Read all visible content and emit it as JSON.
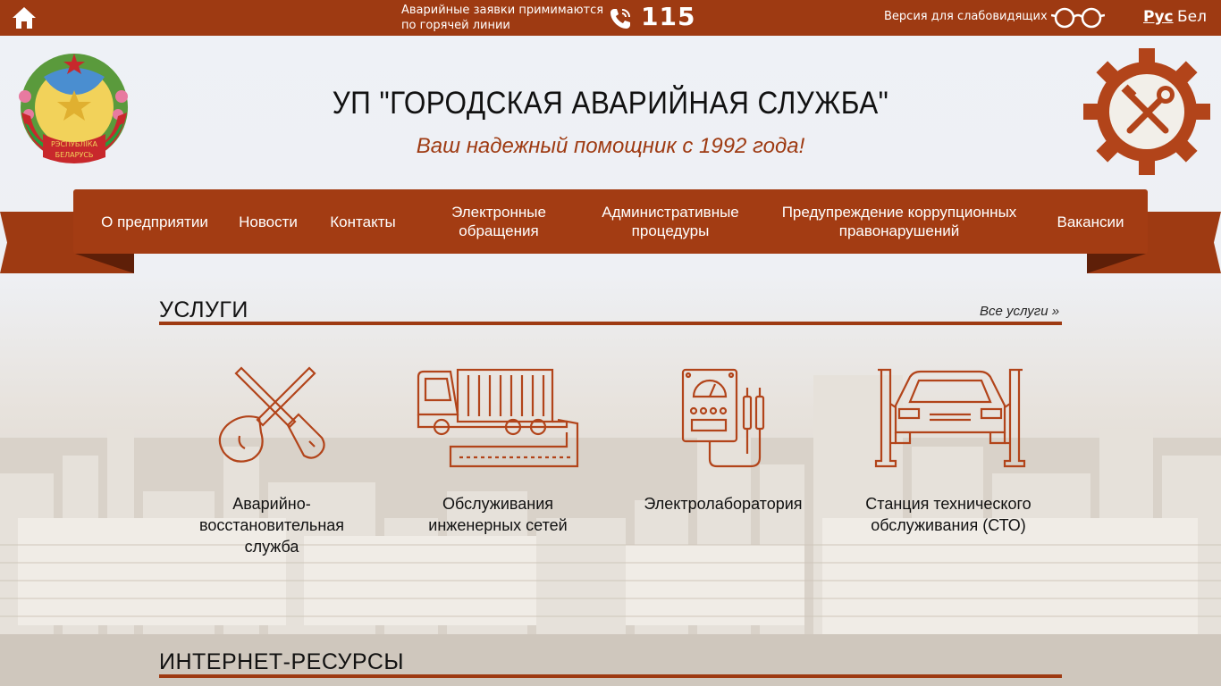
{
  "topbar": {
    "hotline_text_1": "Аварийные заявки примимаются",
    "hotline_text_2": "по горячей линии",
    "phone": "115",
    "vision_label": "Версия для слабовидящих",
    "lang_ru": "Рус",
    "lang_by": "Бел"
  },
  "header": {
    "title": "УП \"ГОРОДСКАЯ АВАРИЙНАЯ СЛУЖБА\"",
    "slogan": "Ваш надежный помощник с 1992 года!",
    "emblem_text_1": "РЭСПУБЛІКА",
    "emblem_text_2": "БЕЛАРУСЬ"
  },
  "nav": {
    "items": [
      {
        "line1": "О предприятии",
        "line2": ""
      },
      {
        "line1": "Новости",
        "line2": ""
      },
      {
        "line1": "Контакты",
        "line2": ""
      },
      {
        "line1": "Электронные",
        "line2": "обращения"
      },
      {
        "line1": "Административные",
        "line2": "процедуры"
      },
      {
        "line1": "Предупреждение коррупционных",
        "line2": "правонарушений"
      },
      {
        "line1": "Вакансии",
        "line2": ""
      }
    ]
  },
  "services_section": {
    "title": "УСЛУГИ",
    "all_link": "Все услуги »",
    "items": [
      {
        "line1": "Аварийно-",
        "line2": "восстановительная",
        "line3": "служба",
        "icon": "tools-icon"
      },
      {
        "line1": "Обслуживания",
        "line2": "инженерных сетей",
        "line3": "",
        "icon": "truck-icon"
      },
      {
        "line1": "Электролаборатория",
        "line2": "",
        "line3": "",
        "icon": "electrolab-icon"
      },
      {
        "line1": "Станция технического",
        "line2": "обслуживания (СТО)",
        "line3": "",
        "icon": "car-lift-icon"
      }
    ]
  },
  "internet_section": {
    "title": "ИНТЕРНЕТ-РЕСУРСЫ"
  },
  "colors": {
    "brand": "#9e3a12",
    "brand_dark": "#5e1f08"
  }
}
